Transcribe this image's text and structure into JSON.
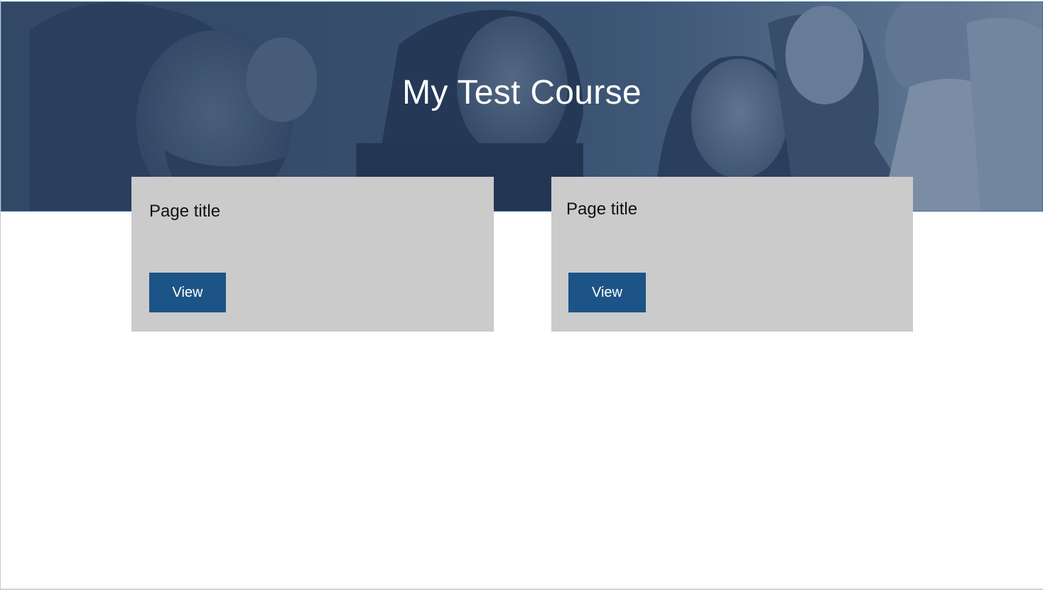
{
  "course": {
    "title": "My Test Course"
  },
  "cards": [
    {
      "title": "Page title",
      "button_label": "View"
    },
    {
      "title": "Page title",
      "button_label": "View"
    }
  ],
  "colors": {
    "hero_overlay": "#2b4a72",
    "card_background": "#cbcbcb",
    "button_background": "#1c5487",
    "button_text": "#ffffff"
  }
}
